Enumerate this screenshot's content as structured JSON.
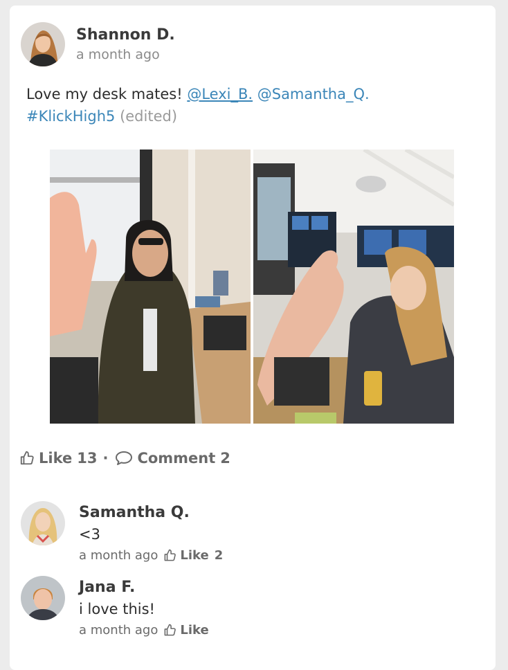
{
  "post": {
    "author": "Shannon D.",
    "time": "a month ago",
    "text_intro": "Love my desk mates! ",
    "mention_1": "@Lexi_B.",
    "mention_2": "@Samantha_Q.",
    "hashtag": "#KlickHigh5",
    "edited": "(edited)"
  },
  "actions": {
    "like_label": "Like",
    "like_count": "13",
    "separator": "·",
    "comment_label": "Comment",
    "comment_count": "2"
  },
  "comments": [
    {
      "author": "Samantha Q.",
      "text": "<3",
      "time": "a month ago",
      "like_label": "Like",
      "like_count": "2"
    },
    {
      "author": "Jana F.",
      "text": "i love this!",
      "time": "a month ago",
      "like_label": "Like"
    }
  ],
  "icons": {
    "like": "thumbs-up-icon",
    "comment": "speech-bubble-icon"
  },
  "colors": {
    "link": "#3b86b8",
    "author": "#3a3a3a",
    "muted": "#8a8a8a",
    "action": "#6a6a6a"
  }
}
